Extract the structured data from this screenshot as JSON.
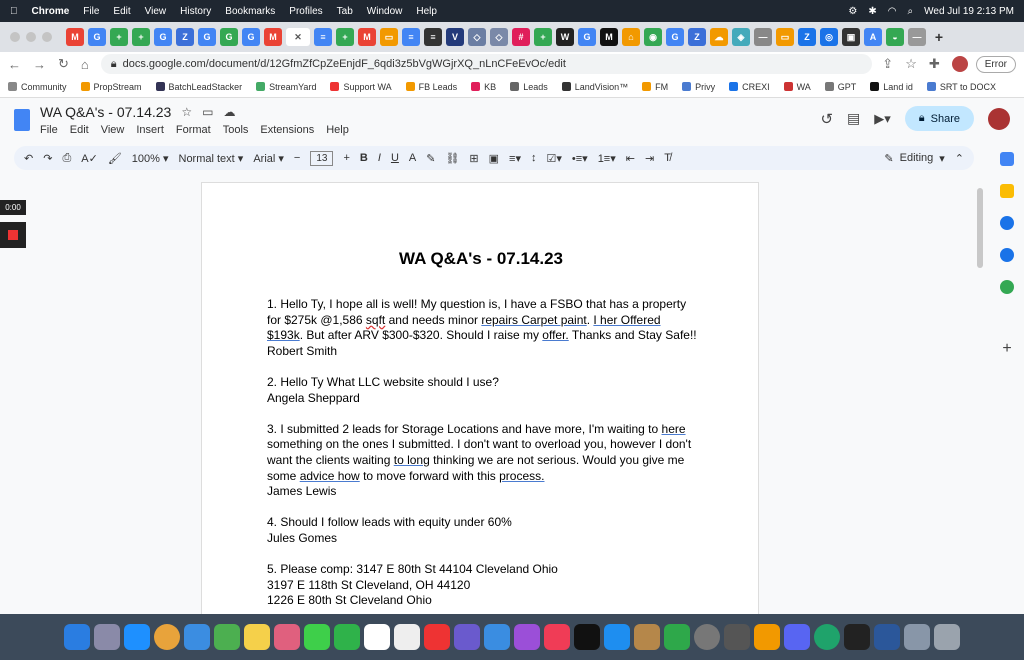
{
  "menubar": {
    "apple": "",
    "app": "Chrome",
    "items": [
      "File",
      "Edit",
      "View",
      "History",
      "Bookmarks",
      "Profiles",
      "Tab",
      "Window",
      "Help"
    ],
    "datetime": "Wed Jul 19  2:13 PM"
  },
  "browser": {
    "url": "docs.google.com/document/d/12GfmZfCpZeEnjdF_6qdi3z5bVgWGjrXQ_nLnCFeEvOc/edit",
    "error_label": "Error",
    "bookmarks": [
      "Community",
      "PropStream",
      "BatchLeadStacker",
      "StreamYard",
      "Support WA",
      "FB Leads",
      "KB",
      "Leads",
      "LandVision™",
      "FM",
      "Privy",
      "CREXI",
      "WA",
      "GPT",
      "Land id",
      "SRT to DOCX"
    ]
  },
  "docs": {
    "title": "WA Q&A's  - 07.14.23",
    "menus": [
      "File",
      "Edit",
      "View",
      "Insert",
      "Format",
      "Tools",
      "Extensions",
      "Help"
    ],
    "share_label": "Share",
    "zoom": "100%",
    "style": "Normal text",
    "font": "Arial",
    "font_size": "13",
    "mode": "Editing"
  },
  "recorder": {
    "timer": "0:00"
  },
  "document": {
    "heading": "WA Q&A's  - 07.14.23",
    "q1_a": "1. Hello Ty, I hope all is well! My question is, I have a FSBO that has a property",
    "q1_b1": "for $275k @1,586 ",
    "q1_b_sqft": "sqft",
    "q1_b2": " and needs minor ",
    "q1_b_rep": "repairs Carpet paint",
    "q1_b3": ". ",
    "q1_b_her": "I her Offered",
    "q1_c_amt": "$193k",
    "q1_c2": ". But after ARV $300-$320. Should I raise my ",
    "q1_c_offer": "offer.",
    "q1_c3": " Thanks and Stay Safe!!",
    "q1_name": "Robert Smith",
    "q2_a": "2. Hello Ty What LLC website should I use?",
    "q2_name": "Angela Sheppard",
    "q3_a1": "3. I submitted 2 leads for Storage Locations and have more, I'm waiting to ",
    "q3_a_here": "here",
    "q3_b": "something on the ones I submitted. I don't want to overload you, however I don't",
    "q3_c1": "want the clients waiting ",
    "q3_c_long": "to long",
    "q3_c2": " thinking we are not serious. Would you give me",
    "q3_d1": "some ",
    "q3_d_advice": "advice how",
    "q3_d2": " to move forward with this ",
    "q3_d_process": "process.",
    "q3_name": "James Lewis",
    "q4_a": "4. Should I follow leads with equity under 60%",
    "q4_name": "Jules Gomes",
    "q5_a": "5. Please comp: 3147 E 80th St 44104 Cleveland Ohio",
    "q5_b": "3197 E 118th St Cleveland, OH 44120",
    "q5_c": "1226 E 80th St Cleveland Ohio"
  }
}
